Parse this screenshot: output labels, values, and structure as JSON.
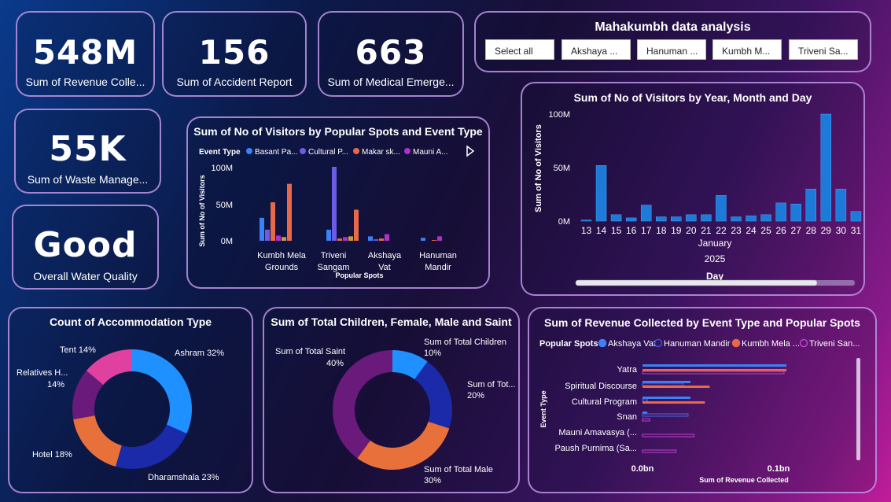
{
  "kpis": {
    "revenue": {
      "value": "548M",
      "label": "Sum of Revenue Colle..."
    },
    "accident": {
      "value": "156",
      "label": "Sum of Accident Report"
    },
    "medical": {
      "value": "663",
      "label": "Sum of Medical Emerge..."
    },
    "waste": {
      "value": "55K",
      "label": "Sum of Waste Manage..."
    },
    "water": {
      "value": "Good",
      "label": "Overall Water Quality"
    }
  },
  "header": {
    "title": "Mahakumbh data analysis",
    "slicers": [
      "Select all",
      "Akshaya ...",
      "Hanuman ...",
      "Kumbh M...",
      "Triveni Sa..."
    ]
  },
  "spots_chart": {
    "title": "Sum of No of Visitors by Popular Spots and Event Type",
    "legend_title": "Event Type",
    "legend": [
      {
        "label": "Basant Pa...",
        "color": "#3b82f6"
      },
      {
        "label": "Cultural P...",
        "color": "#6d5be8"
      },
      {
        "label": "Makar sk...",
        "color": "#e8694a"
      },
      {
        "label": "Mauni A...",
        "color": "#b030c8"
      }
    ],
    "ylabel": "Sum of No of Visitors",
    "xlabel": "Popular Spots",
    "yticks": [
      "100M",
      "50M",
      "0M"
    ]
  },
  "visitors_chart": {
    "title": "Sum of No of Visitors by Year, Month and Day",
    "ylabel": "Sum of No of Visitors",
    "xlabel": "Day",
    "month": "January",
    "year": "2025",
    "yticks": [
      "100M",
      "50M",
      "0M"
    ]
  },
  "accommodation": {
    "title": "Count of Accommodation Type",
    "labels": [
      {
        "name": "Ashram",
        "pct": "32%"
      },
      {
        "name": "Dharamshala",
        "pct": "23%"
      },
      {
        "name": "Hotel",
        "pct": "18%"
      },
      {
        "name": "Relatives H...",
        "pct": "14%"
      },
      {
        "name": "Tent",
        "pct": "14%"
      }
    ]
  },
  "demographics": {
    "title": "Sum of Total Children, Female, Male and Saint",
    "labels": [
      {
        "name": "Sum of Total Children",
        "pct": "10%"
      },
      {
        "name": "Sum of Tot...",
        "pct": "20%"
      },
      {
        "name": "Sum of Total Male",
        "pct": "30%"
      },
      {
        "name": "Sum of Total Saint",
        "pct": "40%"
      }
    ]
  },
  "revenue_chart": {
    "title": "Sum of Revenue Collected by Event Type and Popular Spots",
    "legend_title": "Popular Spots",
    "legend": [
      {
        "label": "Akshaya Vat",
        "color": "#3b82f6",
        "hollow": false
      },
      {
        "label": "Hanuman Mandir",
        "color": "#3b4ed8",
        "hollow": true
      },
      {
        "label": "Kumbh Mela ...",
        "color": "#e8694a",
        "hollow": false
      },
      {
        "label": "Triveni San...",
        "color": "#c040d0",
        "hollow": true
      }
    ],
    "ylabel": "Event Type",
    "xlabel": "Sum of Revenue Collected",
    "xticks": [
      "0.0bn",
      "0.1bn"
    ]
  },
  "chart_data": [
    {
      "type": "bar",
      "title": "Sum of No of Visitors by Popular Spots and Event Type",
      "categories": [
        "Kumbh Mela Grounds",
        "Triveni Sangam",
        "Akshaya Vat",
        "Hanuman Mandir"
      ],
      "series": [
        {
          "name": "Basant Pa...",
          "color": "#3b82f6",
          "values": [
            31,
            15,
            6,
            4
          ]
        },
        {
          "name": "Cultural P...",
          "color": "#6d5be8",
          "values": [
            15,
            100,
            2,
            0
          ]
        },
        {
          "name": "Makar sk...",
          "color": "#e8694a",
          "values": [
            52,
            3,
            3,
            1
          ]
        },
        {
          "name": "Mauni A...",
          "color": "#b030c8",
          "values": [
            7,
            5,
            9,
            6
          ]
        },
        {
          "name": "",
          "color": "#c0a040",
          "values": [
            5,
            6,
            0,
            0
          ]
        },
        {
          "name": "",
          "color": "#e8694a",
          "values": [
            77,
            42,
            0,
            0
          ]
        }
      ],
      "xlabel": "Popular Spots",
      "ylabel": "Sum of No of Visitors",
      "ylim": [
        0,
        110
      ]
    },
    {
      "type": "bar",
      "title": "Sum of No of Visitors by Year, Month and Day",
      "categories": [
        "13",
        "14",
        "15",
        "16",
        "17",
        "18",
        "19",
        "20",
        "21",
        "22",
        "23",
        "24",
        "25",
        "26",
        "27",
        "28",
        "29",
        "30",
        "31"
      ],
      "values": [
        1,
        52,
        6,
        3,
        15,
        4,
        4,
        6,
        6,
        24,
        4,
        5,
        6,
        17,
        16,
        30,
        100,
        30,
        9
      ],
      "xlabel": "Day",
      "ylabel": "Sum of No of Visitors",
      "ylim": [
        0,
        100
      ]
    },
    {
      "type": "pie",
      "title": "Count of Accommodation Type",
      "labels": [
        "Ashram",
        "Dharamshala",
        "Hotel",
        "Relatives H...",
        "Tent"
      ],
      "values": [
        32,
        23,
        18,
        14,
        14
      ],
      "colors": [
        "#1e90ff",
        "#1a2aa8",
        "#e8703a",
        "#6a1a7a",
        "#e040a0"
      ]
    },
    {
      "type": "pie",
      "title": "Sum of Total Children, Female, Male and Saint",
      "labels": [
        "Sum of Total Children",
        "Sum of Tot...",
        "Sum of Total Male",
        "Sum of Total Saint"
      ],
      "values": [
        10,
        20,
        30,
        40
      ],
      "colors": [
        "#1e90ff",
        "#1a2aa8",
        "#e8703a",
        "#6a1a7a"
      ]
    },
    {
      "type": "bar",
      "title": "Sum of Revenue Collected by Event Type and Popular Spots",
      "categories": [
        "Yatra",
        "Spiritual Discourse",
        "Cultural Program",
        "Snan",
        "Mauni Amavasya (...",
        "Paush Purnima (Sa..."
      ],
      "series": [
        {
          "name": "Akshaya Vat",
          "values": [
            0.12,
            0.04,
            0.04,
            0.004,
            0,
            0
          ]
        },
        {
          "name": "Hanuman Mandir",
          "values": [
            0,
            0.034,
            0.004,
            0.038,
            0,
            0
          ]
        },
        {
          "name": "Kumbh Mela ...",
          "values": [
            0.12,
            0.056,
            0.052,
            0,
            0,
            0
          ]
        },
        {
          "name": "Triveni San...",
          "values": [
            0.118,
            0,
            0,
            0.006,
            0.043,
            0.028
          ]
        }
      ],
      "xlabel": "Sum of Revenue Collected",
      "ylabel": "Event Type",
      "xlim": [
        0,
        0.12
      ]
    }
  ]
}
